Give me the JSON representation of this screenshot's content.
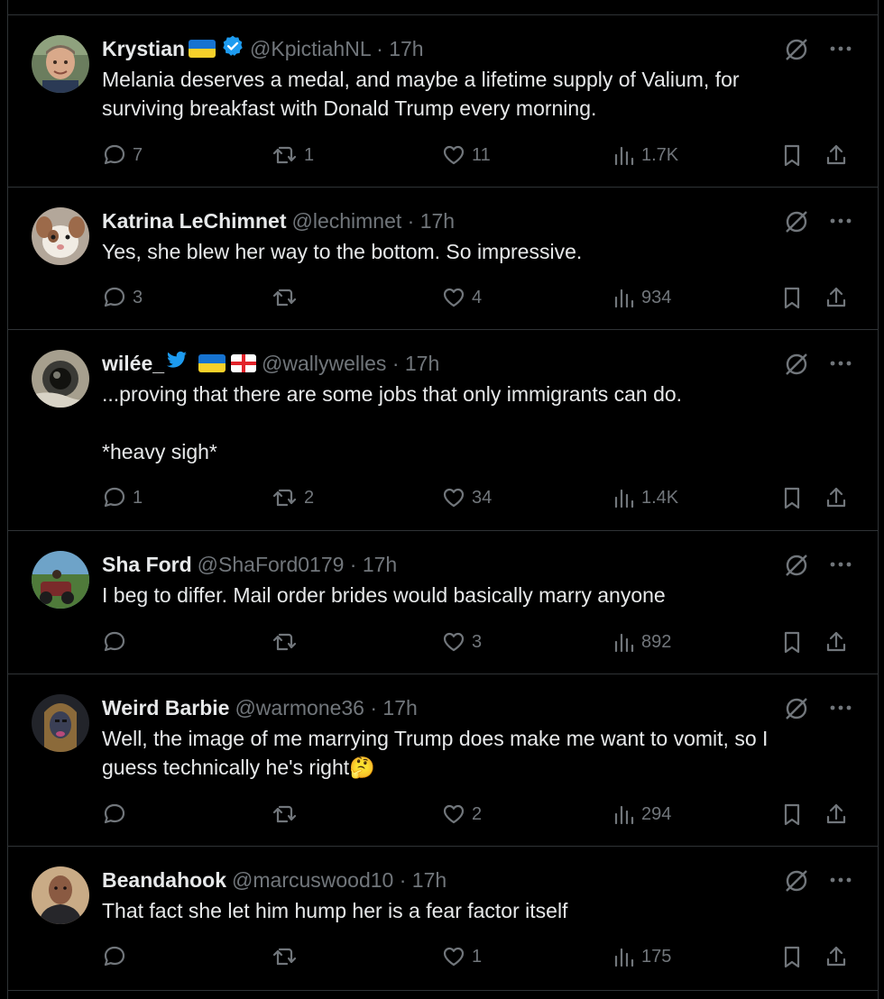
{
  "icons": {
    "reply": "reply-icon",
    "retweet": "retweet-icon",
    "like": "heart-icon",
    "views": "views-icon",
    "bookmark": "bookmark-icon",
    "share": "share-icon",
    "grok": "grok-icon",
    "more": "more-icon"
  },
  "colors": {
    "background": "#000000",
    "text": "#e7e9ea",
    "muted": "#71767b",
    "divider": "#2f3336",
    "verified": "#1d9bf0"
  },
  "tweets": [
    {
      "name": "Krystian",
      "handle_time": "@KpictiahNL · 17h",
      "text": [
        "Melania deserves a medal, and maybe a lifetime supply of Valium, for surviving breakfast with Donald Trump every morning."
      ],
      "replies": "7",
      "retweets": "1",
      "likes": "11",
      "views": "1.7K"
    },
    {
      "name": "Katrina LeChimnet",
      "handle_time": "@lechimnet · 17h",
      "text": [
        "Yes, she blew her way to the bottom. So impressive."
      ],
      "replies": "3",
      "retweets": "",
      "likes": "4",
      "views": "934"
    },
    {
      "name": "wilée_",
      "handle_time": "@wallywelles · 17h",
      "text": [
        "...proving that there are some jobs that only immigrants can do.",
        "*heavy sigh*"
      ],
      "replies": "1",
      "retweets": "2",
      "likes": "34",
      "views": "1.4K"
    },
    {
      "name": "Sha Ford",
      "handle_time": "@ShaFord0179 · 17h",
      "text": [
        "I beg to differ. Mail order brides would basically marry anyone"
      ],
      "replies": "",
      "retweets": "",
      "likes": "3",
      "views": "892"
    },
    {
      "name": "Weird Barbie",
      "handle_time": "@warmone36 · 17h",
      "text": [
        "Well, the image of me marrying Trump does make me want to vomit, so I guess technically he's right🤔"
      ],
      "replies": "",
      "retweets": "",
      "likes": "2",
      "views": "294"
    },
    {
      "name": "Beandahook",
      "handle_time": "@marcuswood10 · 17h",
      "text": [
        "That fact she let him hump her is a fear factor itself"
      ],
      "replies": "",
      "retweets": "",
      "likes": "1",
      "views": "175"
    }
  ]
}
